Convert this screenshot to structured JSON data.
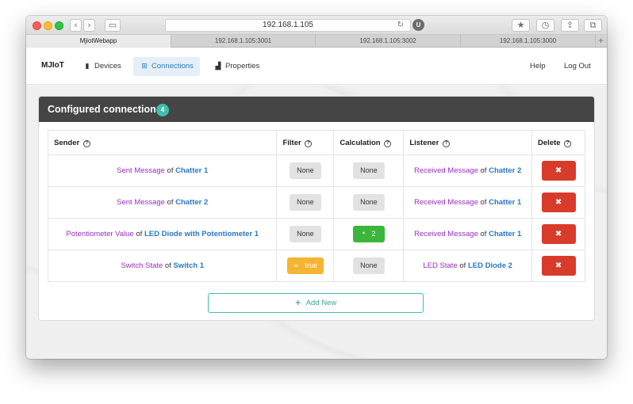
{
  "browser": {
    "url": "192.168.1.105",
    "reload_icon": "reload-icon",
    "extension_badge": "U",
    "tabs": [
      {
        "label": "MjiotWebapp",
        "active": true
      },
      {
        "label": "192.168.1.105:3001",
        "active": false
      },
      {
        "label": "192.168.1.105:3002",
        "active": false
      },
      {
        "label": "192.168.1.105:3000",
        "active": false
      }
    ],
    "new_tab_label": "+"
  },
  "nav": {
    "brand": "MJIoT",
    "items": [
      {
        "label": "Devices",
        "icon": "device-icon",
        "active": false
      },
      {
        "label": "Connections",
        "icon": "sitemap-icon",
        "active": true
      },
      {
        "label": "Properties",
        "icon": "chart-icon",
        "active": false
      }
    ],
    "help": "Help",
    "logout": "Log Out"
  },
  "panel": {
    "title": "Configured connections",
    "count": "4",
    "columns": {
      "sender": "Sender",
      "filter": "Filter",
      "calculation": "Calculation",
      "listener": "Listener",
      "delete": "Delete"
    },
    "rows": [
      {
        "sender_property": "Sent Message",
        "of": "of",
        "sender_device": "Chatter 1",
        "filter": "None",
        "filter_style": "default",
        "filter_icon": "",
        "calculation": "None",
        "calc_style": "default",
        "calc_icon": "",
        "listener_property": "Received Message",
        "listener_device": "Chatter 2",
        "delete_label": "✖"
      },
      {
        "sender_property": "Sent Message",
        "of": "of",
        "sender_device": "Chatter 2",
        "filter": "None",
        "filter_style": "default",
        "filter_icon": "",
        "calculation": "None",
        "calc_style": "default",
        "calc_icon": "",
        "listener_property": "Received Message",
        "listener_device": "Chatter 1",
        "delete_label": "✖"
      },
      {
        "sender_property": "Potentiometer Value",
        "of": "of",
        "sender_device": "LED Diode with Potentiometer 1",
        "filter": "None",
        "filter_style": "default",
        "filter_icon": "",
        "calculation": "2",
        "calc_style": "green",
        "calc_icon": "*",
        "listener_property": "Received Message",
        "listener_device": "Chatter 1",
        "delete_label": "✖"
      },
      {
        "sender_property": "Switch State",
        "of": "of",
        "sender_device": "Switch 1",
        "filter": "true",
        "filter_style": "yellow",
        "filter_icon": "=",
        "calculation": "None",
        "calc_style": "default",
        "calc_icon": "",
        "listener_property": "LED State",
        "listener_device": "LED Diode 2",
        "delete_label": "✖"
      }
    ],
    "add_new": "Add New",
    "add_new_icon": "+"
  },
  "colors": {
    "accent_teal": "#3fbfad",
    "property_purple": "#9b2bc4",
    "device_blue": "#2a78c4",
    "delete_red": "#d93b2b",
    "calc_green": "#3bb53b",
    "filter_yellow": "#f5b532",
    "header_dark": "#454545"
  }
}
